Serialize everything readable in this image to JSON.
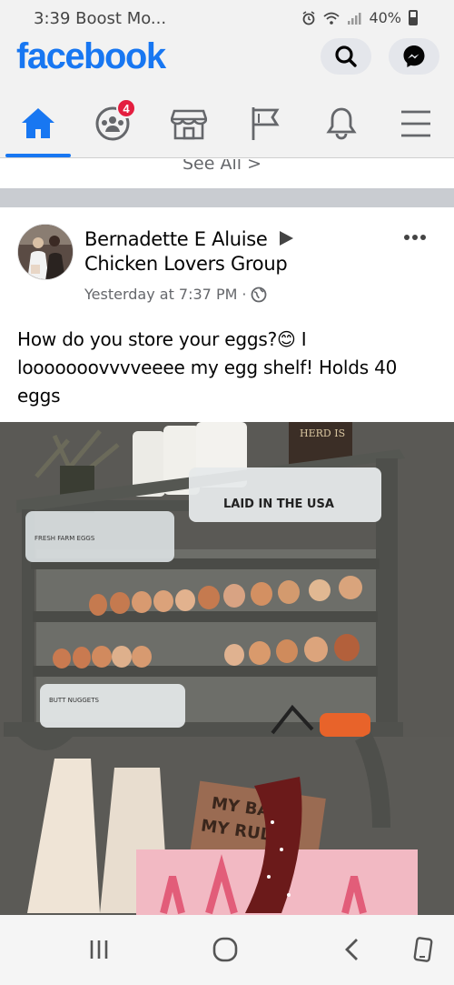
{
  "status": {
    "time": "3:39",
    "carrier": "Boost Mo...",
    "battery": "40%"
  },
  "header": {
    "logo": "facebook",
    "search_icon": "search-icon",
    "messenger_icon": "messenger-icon"
  },
  "nav": {
    "active_tab": "home",
    "tabs": [
      {
        "name": "home",
        "icon": "home-icon"
      },
      {
        "name": "groups",
        "icon": "groups-icon",
        "badge": "4"
      },
      {
        "name": "marketplace",
        "icon": "marketplace-icon"
      },
      {
        "name": "pages",
        "icon": "flag-icon"
      },
      {
        "name": "notifications",
        "icon": "bell-icon"
      },
      {
        "name": "menu",
        "icon": "hamburger-icon"
      }
    ]
  },
  "feed": {
    "see_all": "See All >"
  },
  "post": {
    "author": "Bernadette E Aluise",
    "group": "Chicken Lovers Group",
    "timestamp": "Yesterday at 7:37 PM",
    "separator": "·",
    "text": "How do you store your eggs?😊 I looooooovvvveeee my egg shelf! Holds 40 eggs",
    "photo": {
      "carton_top_left": "LAID IN THE USA",
      "sign_top": "HERD IS",
      "sign_bottom": "MY BARN MY RULES",
      "carton_labels": [
        "FRESH FARM EGGS",
        "BUTT NUGGETS"
      ]
    }
  },
  "colors": {
    "brand": "#1877f2",
    "badge": "#e41e3f",
    "background": "#f2f2f2"
  }
}
